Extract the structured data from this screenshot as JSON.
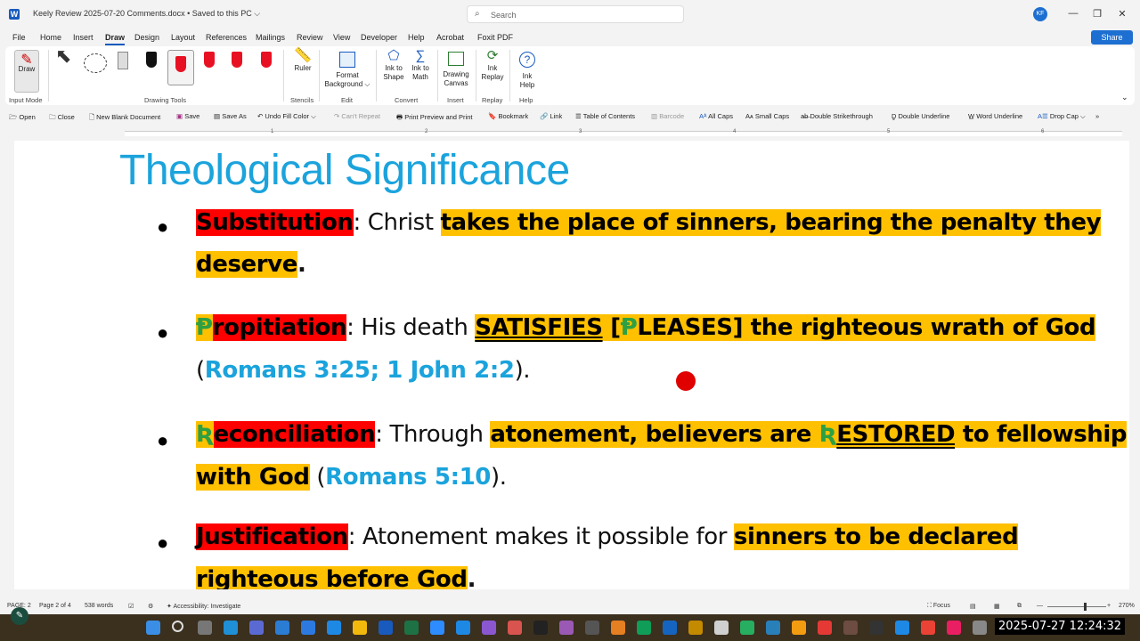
{
  "titlebar": {
    "app_letter": "W",
    "doc_title": "Keely Review 2025-07-20 Comments.docx • Saved to this PC ⌵",
    "search_placeholder": "Search",
    "avatar": "KF"
  },
  "menu": [
    "File",
    "Home",
    "Insert",
    "Draw",
    "Design",
    "Layout",
    "References",
    "Mailings",
    "Review",
    "View",
    "Developer",
    "Help",
    "Acrobat",
    "Foxit PDF"
  ],
  "share_label": "Share",
  "ribbon": {
    "draw_label": "Draw",
    "input_mode_label": "Input Mode",
    "drawing_tools_label": "Drawing Tools",
    "ruler_label": "Ruler",
    "stencils_label": "Stencils",
    "format_bg_label1": "Format",
    "format_bg_label2": "Background ⌵",
    "edit_label": "Edit",
    "ink_shape1": "Ink to",
    "ink_shape2": "Shape",
    "ink_math1": "Ink to",
    "ink_math2": "Math",
    "convert_label": "Convert",
    "drawing_canvas1": "Drawing",
    "drawing_canvas2": "Canvas",
    "insert_label": "Insert",
    "ink_replay1": "Ink",
    "ink_replay2": "Replay",
    "replay_label": "Replay",
    "ink_help1": "Ink",
    "ink_help2": "Help",
    "help_label": "Help",
    "pen_colors": [
      "#111111",
      "#e81123",
      "#e81123",
      "#e81123",
      "#e81123",
      "#e040d0"
    ]
  },
  "qat": {
    "open": "Open",
    "close": "Close",
    "new_blank": "New Blank Document",
    "save": "Save",
    "save_as": "Save As",
    "undo": "Undo Fill Color",
    "redo": "Can't Repeat",
    "print_preview": "Print Preview and Print",
    "bookmark": "Bookmark",
    "link": "Link",
    "toc": "Table of Contents",
    "barcode": "Barcode",
    "all_caps": "All Caps",
    "small_caps": "Small Caps",
    "double_strike": "Double Strikethrough",
    "double_underline": "Double Underline",
    "word_underline": "Word Underline",
    "drop_cap": "Drop Cap ⌵"
  },
  "ruler_numbers": [
    "1",
    "2",
    "3",
    "4",
    "5",
    "6"
  ],
  "document": {
    "heading": "Theological Significance",
    "items": [
      {
        "term": "Substitution",
        "sep": ": Christ ",
        "hl1": "takes the place of sinners, bearing the penalty they",
        "line2_hl": "deserve",
        "line2_end": "."
      },
      {
        "glyph": "Ᵽ",
        "term": "ropitiation",
        "sep": ": His death ",
        "hl_a": "SATISFIES",
        "hl_b": " [",
        "glyph2": "Ᵽ",
        "hl_c": "LEASES] the righteous wrath of God",
        "line2_open": "(",
        "line2_ref": "Romans 3:25; 1 John 2:2",
        "line2_close": ")."
      },
      {
        "glyph": "Ʀ",
        "term": "econciliation",
        "sep": ": Through ",
        "hl_a": "atonement, believers are ",
        "glyph2": "Ʀ",
        "hl_b": "ESTORED",
        "hl_c": " to fellowship",
        "line2_hl": "with God",
        "line2_open": " (",
        "line2_ref": "Romans 5:10",
        "line2_close": ")."
      },
      {
        "term": "Justification",
        "sep": ": Atonement makes it possible for ",
        "hl1": "sinners to be declared",
        "line2_hl": "righteous before God",
        "line2_end": "."
      }
    ]
  },
  "status": {
    "page_field": "PAGE: 2",
    "page_of": "Page 2 of 4",
    "words": "538 words",
    "accessibility": "Accessibility: Investigate",
    "focus": "Focus",
    "zoom": "270%"
  },
  "clock": "2025-07-27  12:24:32"
}
